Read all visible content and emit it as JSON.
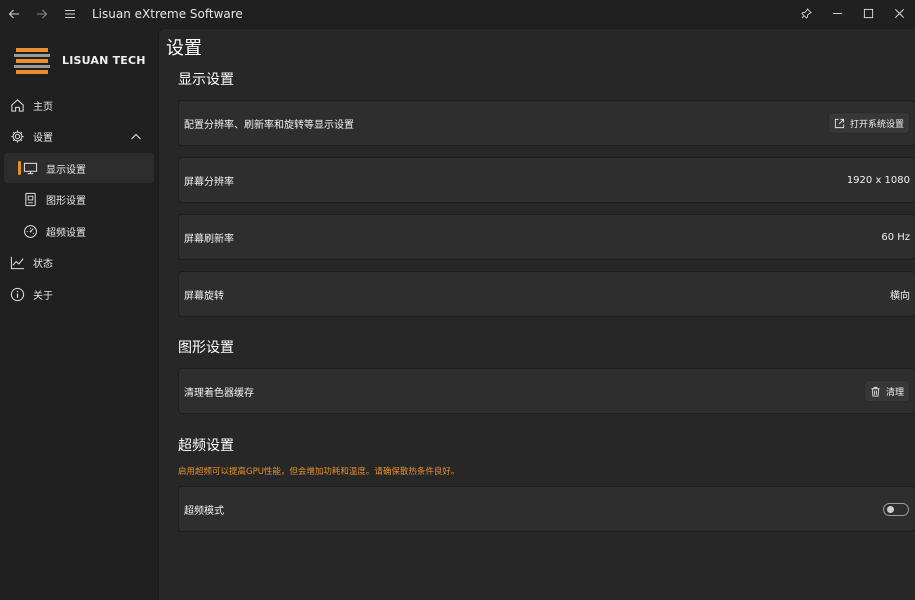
{
  "window": {
    "title": "Lisuan eXtreme Software"
  },
  "brand": {
    "name": "LISUAN TECH",
    "accent": "#e8912c"
  },
  "nav": [
    {
      "label": "主页",
      "icon": "home-icon"
    },
    {
      "label": "设置",
      "icon": "gear-icon",
      "expanded": true
    },
    {
      "label": "显示设置",
      "icon": "monitor-icon",
      "selected": true
    },
    {
      "label": "图形设置",
      "icon": "gpu-icon"
    },
    {
      "label": "超频设置",
      "icon": "gauge-icon"
    },
    {
      "label": "状态",
      "icon": "chart-line-icon"
    },
    {
      "label": "关于",
      "icon": "info-icon"
    }
  ],
  "page": {
    "title": "设置"
  },
  "display": {
    "section_title": "显示设置",
    "configure_label": "配置分辨率、刷新率和旋转等显示设置",
    "open_system_settings": "打开系统设置",
    "resolution_label": "屏幕分辨率",
    "resolution_value": "1920 x 1080",
    "refresh_label": "屏幕刷新率",
    "refresh_value": "60 Hz",
    "rotation_label": "屏幕旋转",
    "rotation_value": "横向"
  },
  "graphics": {
    "section_title": "图形设置",
    "shader_cache_label": "清理着色器缓存",
    "clear_button": "清理"
  },
  "overclock": {
    "section_title": "超频设置",
    "warning": "启用超频可以提高GPU性能，但会增加功耗和温度。请确保散热条件良好。",
    "mode_label": "超频模式",
    "mode_enabled": false
  }
}
